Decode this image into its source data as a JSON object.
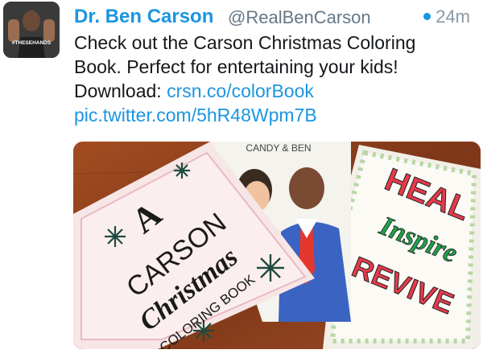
{
  "tweet": {
    "author_name": "Dr. Ben Carson",
    "handle": "@RealBenCarson",
    "time": "24m",
    "text_line1": "Check out the Carson Christmas Coloring",
    "text_line2": "Book. Perfect for entertaining your kids!",
    "text_download_prefix": "Download: ",
    "link_url": "crsn.co/colorBook",
    "pic_link": "pic.twitter.com/5hR48Wpm7B",
    "avatar_text": "#THESEHANDS"
  },
  "media": {
    "book1": {
      "letter_a": "A",
      "carson": "CARSON",
      "christmas": "Christmas",
      "coloring_book": "COLORING BOOK"
    },
    "book2": {
      "header": "CANDY & BEN"
    },
    "book3": {
      "heal": "HEAL",
      "inspire": "Inspire",
      "revive": "REVIVE"
    }
  },
  "colors": {
    "link_blue": "#1b95e0",
    "handle_gray": "#657786",
    "time_gray": "#8899a6",
    "table_wood": "#8a3f1f"
  },
  "icons": {
    "unread_dot": "blue-dot-icon"
  }
}
